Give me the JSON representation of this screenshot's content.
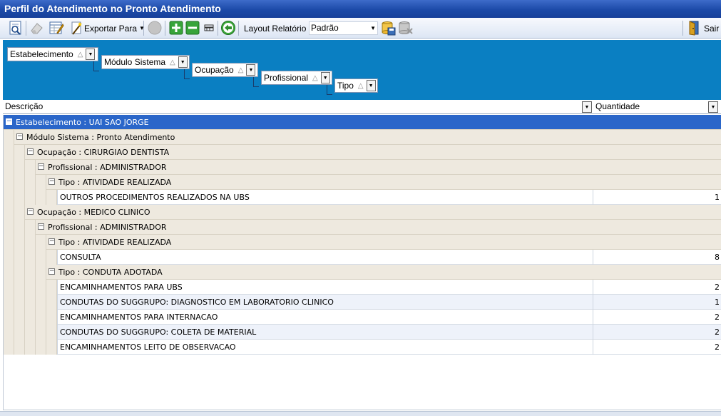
{
  "window": {
    "title": "Perfil do Atendimento no Pronto Atendimento"
  },
  "toolbar": {
    "export_label": "Exportar Para",
    "layout_label": "Layout Relatório",
    "layout_value": "Padrão",
    "exit_label": "Sair"
  },
  "grouping": [
    {
      "label": "Estabelecimento"
    },
    {
      "label": "Módulo Sistema"
    },
    {
      "label": "Ocupação"
    },
    {
      "label": "Profissional"
    },
    {
      "label": "Tipo"
    }
  ],
  "sort_glyph": "△",
  "columns": {
    "description": "Descrição",
    "quantity": "Quantidade"
  },
  "groups": {
    "g1": "Estabelecimento : UAI SAO JORGE",
    "g2": "Módulo Sistema :  Pronto Atendimento",
    "g3": "Ocupação : CIRURGIAO DENTISTA",
    "g4": "Profissional : ADMINISTRADOR",
    "g5": "Tipo : ATIVIDADE REALIZADA",
    "g6": "Ocupação : MEDICO CLINICO",
    "g7": "Profissional : ADMINISTRADOR",
    "g8": "Tipo : ATIVIDADE REALIZADA",
    "g9": "Tipo : CONDUTA ADOTADA"
  },
  "rows": [
    {
      "description": "OUTROS PROCEDIMENTOS REALIZADOS NA UBS",
      "quantity": "1"
    },
    {
      "description": "CONSULTA",
      "quantity": "8"
    },
    {
      "description": "ENCAMINHAMENTOS PARA UBS",
      "quantity": "2"
    },
    {
      "description": "CONDUTAS DO SUGGRUPO: DIAGNOSTICO EM LABORATORIO CLINICO",
      "quantity": "1"
    },
    {
      "description": "ENCAMINHAMENTOS PARA INTERNACAO",
      "quantity": "2"
    },
    {
      "description": "CONDUTAS DO SUGGRUPO: COLETA DE MATERIAL",
      "quantity": "2"
    },
    {
      "description": "ENCAMINHAMENTOS LEITO DE OBSERVACAO",
      "quantity": "2"
    }
  ]
}
